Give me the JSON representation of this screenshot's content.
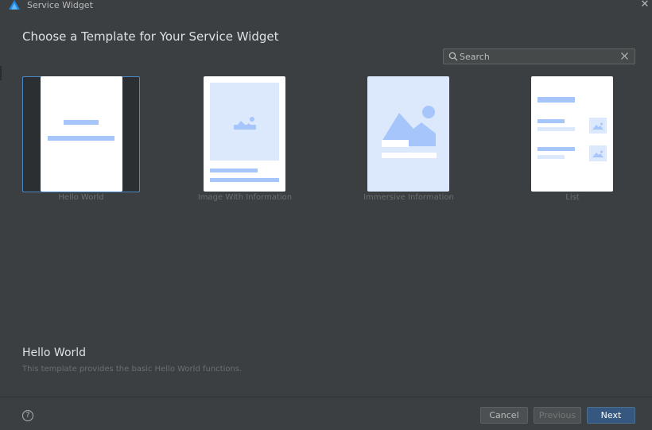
{
  "window": {
    "title": "Service Widget",
    "app_icon": "deveco-logo-icon",
    "close_icon": "close-icon"
  },
  "dialog": {
    "heading": "Choose a Template for Your Service Widget",
    "search": {
      "placeholder": "Search",
      "value": ""
    },
    "templates": [
      {
        "label": "Hello World",
        "selected": true
      },
      {
        "label": "Image With Information",
        "selected": false
      },
      {
        "label": "Immersive Information",
        "selected": false
      },
      {
        "label": "List",
        "selected": false
      }
    ],
    "description": {
      "title": "Hello World",
      "text": "This template provides the basic Hello World functions."
    },
    "buttons": {
      "cancel": "Cancel",
      "previous": "Previous",
      "next": "Next"
    },
    "help_label": "?"
  },
  "colors": {
    "accent": "#4a88c7",
    "primary_button": "#365880",
    "placeholder_fill": "#a6c6fb",
    "placeholder_bg": "#dce8fc"
  }
}
